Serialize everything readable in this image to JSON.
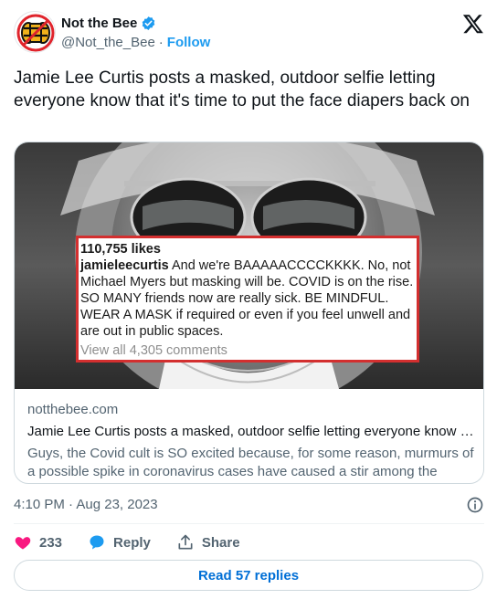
{
  "author": {
    "name": "Not the Bee",
    "handle": "@Not_the_Bee",
    "separator": "·",
    "follow_label": "Follow"
  },
  "tweet": {
    "text": "Jamie Lee Curtis posts a masked, outdoor selfie letting everyone know that it's time to put the face diapers back on"
  },
  "card": {
    "embedded_post": {
      "likes": "110,755 likes",
      "username": "jamieleecurtis",
      "caption": " And we're BAAAAACCCCKKKK. No, not Michael Myers but masking will be.  COVID is on the rise. SO MANY friends now are really sick. BE MINDFUL. WEAR A MASK if required or even if you feel unwell and are out in public spaces.",
      "comments_link": "View all 4,305 comments"
    },
    "domain": "notthebee.com",
    "title": "Jamie Lee Curtis posts a masked, outdoor selfie letting everyone know t...",
    "description": "Guys, the Covid cult is SO excited because, for some reason, murmurs of a possible spike in coronavirus cases have caused a stir among the maskers."
  },
  "meta": {
    "timestamp": "4:10 PM · Aug 23, 2023"
  },
  "actions": {
    "like_count": "233",
    "reply_label": "Reply",
    "share_label": "Share"
  },
  "read_replies_label": "Read 57 replies",
  "colors": {
    "like": "#f91880",
    "reply": "#1d9bf0",
    "link": "#1d9bf0",
    "verified": "#1d9bf0",
    "highlight_border": "#d32f2f"
  },
  "icons": {
    "avatar": "not-the-bee-logo",
    "verified": "verified-badge-icon",
    "brand": "x-logo-icon",
    "info": "info-icon",
    "like": "heart-icon",
    "reply": "speech-bubble-icon",
    "share": "share-arrow-icon"
  }
}
